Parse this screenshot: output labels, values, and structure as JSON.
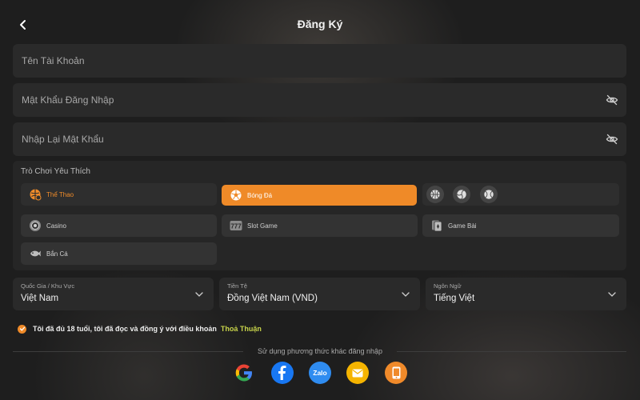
{
  "header": {
    "title": "Đăng Ký"
  },
  "form": {
    "username_placeholder": "Tên Tài Khoản",
    "password_placeholder": "Mật Khẩu Đăng Nhập",
    "confirm_placeholder": "Nhập Lại Mật Khẩu"
  },
  "games": {
    "title": "Trò Chơi Yêu Thích",
    "tabs": [
      {
        "label": "Thể Thao",
        "icon": "sports-icon",
        "state": "selected-tab"
      },
      {
        "label": "Bóng Đá",
        "icon": "football-icon",
        "state": "active"
      },
      {
        "label": "Casino",
        "icon": "casino-chip-icon",
        "state": "normal"
      },
      {
        "label": "Slot Game",
        "icon": "slot-777-icon",
        "state": "normal"
      },
      {
        "label": "Game Bài",
        "icon": "cards-icon",
        "state": "normal"
      },
      {
        "label": "Bắn Cá",
        "icon": "fish-icon",
        "state": "normal"
      }
    ],
    "extra_sport_icons": [
      "basketball-icon",
      "volleyball-icon",
      "tennis-ball-icon"
    ]
  },
  "selects": {
    "country": {
      "label": "Quốc Gia / Khu Vực",
      "value": "Việt Nam"
    },
    "currency": {
      "label": "Tiền Tệ",
      "value": "Đồng Việt Nam (VND)"
    },
    "language": {
      "label": "Ngôn Ngữ",
      "value": "Tiếng Việt"
    }
  },
  "agreement": {
    "text": "Tôi đã đủ 18 tuổi, tôi đã đọc và đồng ý với điều khoản",
    "link": "Thoả Thuận",
    "checked": true
  },
  "other_login": {
    "text": "Sử dụng phương thức khác đăng nhập",
    "methods": [
      {
        "name": "google",
        "icon": "google-icon"
      },
      {
        "name": "facebook",
        "icon": "facebook-icon"
      },
      {
        "name": "zalo",
        "icon": "zalo-icon",
        "label": "Zalo"
      },
      {
        "name": "email",
        "icon": "email-icon"
      },
      {
        "name": "phone",
        "icon": "phone-icon"
      }
    ]
  },
  "colors": {
    "accent": "#ef8a28",
    "link": "#c7d34a",
    "facebook": "#1877f2",
    "zalo": "#2f8cf0",
    "email": "#f5b400",
    "phone": "#f08a2a"
  }
}
